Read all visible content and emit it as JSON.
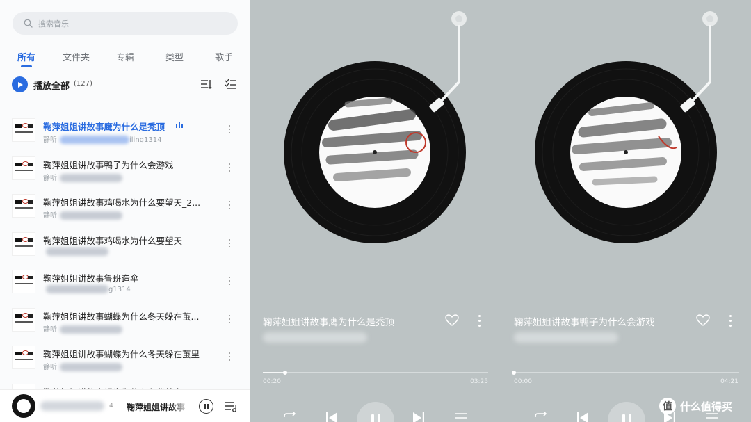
{
  "search": {
    "placeholder": "搜索音乐"
  },
  "tabs": [
    {
      "label": "所有",
      "active": true
    },
    {
      "label": "文件夹"
    },
    {
      "label": "专辑"
    },
    {
      "label": "类型"
    },
    {
      "label": "歌手"
    }
  ],
  "play_all": {
    "label": "播放全部",
    "count": "(127)"
  },
  "songs": [
    {
      "title": "鞠萍姐姐讲故事鹰为什么是秃顶",
      "sub_prefix": "静听",
      "sub_suffix": "iling1314",
      "active": true
    },
    {
      "title": "鞠萍姐姐讲故事鸭子为什么会游戏",
      "sub_prefix": "静听",
      "sub_suffix": ""
    },
    {
      "title": "鞠萍姐姐讲故事鸡喝水为什么要望天_2...",
      "sub_prefix": "静听",
      "sub_suffix": ""
    },
    {
      "title": "鞠萍姐姐讲故事鸡喝水为什么要望天",
      "sub_prefix": "",
      "sub_suffix": ""
    },
    {
      "title": "鞠萍姐姐讲故事鲁班造伞",
      "sub_prefix": "",
      "sub_suffix": "g1314"
    },
    {
      "title": "鞠萍姐姐讲故事蝴蝶为什么冬天躲在茧...",
      "sub_prefix": "静听",
      "sub_suffix": ""
    },
    {
      "title": "鞠萍姐姐讲故事蝴蝶为什么冬天躲在茧里",
      "sub_prefix": "静听",
      "sub_suffix": ""
    },
    {
      "title": "鞠萍姐姐讲故事蜗牛为什么在背着房子",
      "sub_prefix": "",
      "sub_suffix": ""
    }
  ],
  "mini_player": {
    "number": "4",
    "title": "鞠萍姐姐讲故事"
  },
  "players": [
    {
      "title": "鞠萍姐姐讲故事鹰为什么是秃顶",
      "subtitle_suffix": "14",
      "current_time": "00:20",
      "total_time": "03:25",
      "progress": 0.1
    },
    {
      "title": "鞠萍姐姐讲故事鸭子为什么会游戏",
      "subtitle_suffix": "",
      "current_time": "00:00",
      "total_time": "04:21",
      "progress": 0.0
    }
  ],
  "watermark": {
    "logo": "值",
    "text": "什么值得买"
  },
  "colors": {
    "accent": "#2a6ce0",
    "player_bg": "#bcc3c4"
  }
}
